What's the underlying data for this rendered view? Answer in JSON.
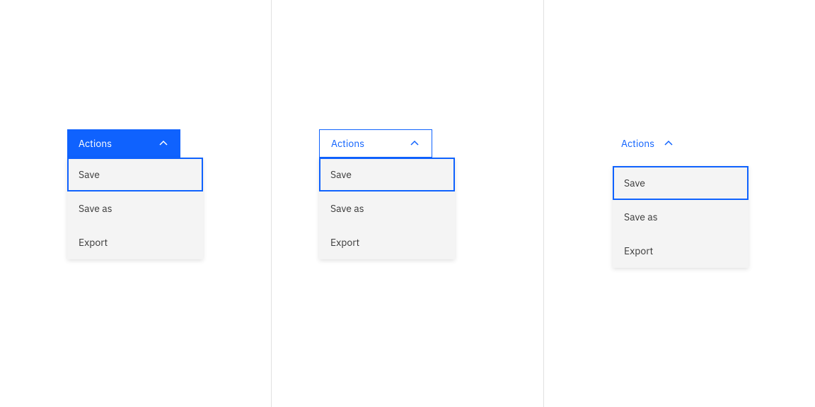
{
  "colors": {
    "primary": "#0f62fe",
    "menu_bg": "#f4f4f4",
    "text": "#393939",
    "divider": "#e0e0e0"
  },
  "dropdown": {
    "trigger_label": "Actions",
    "items": [
      {
        "label": "Save",
        "focused": true
      },
      {
        "label": "Save as",
        "focused": false
      },
      {
        "label": "Export",
        "focused": false
      }
    ]
  },
  "variants": [
    {
      "kind": "primary-solid"
    },
    {
      "kind": "outline"
    },
    {
      "kind": "ghost"
    }
  ]
}
